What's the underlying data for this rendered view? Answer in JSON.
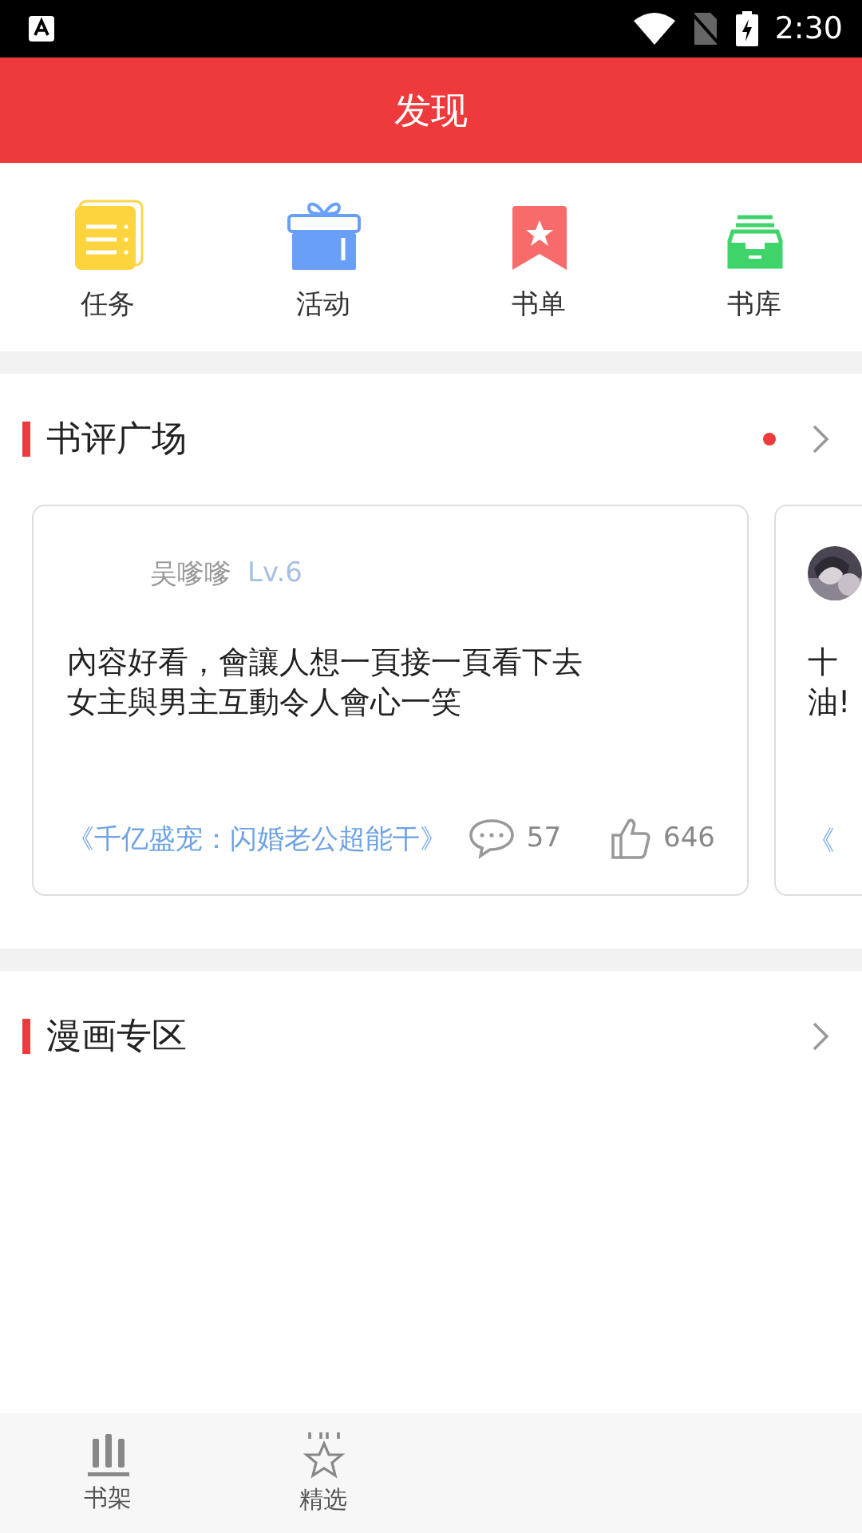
{
  "status_bar": {
    "time": "2:30"
  },
  "header": {
    "title": "发现"
  },
  "quick_nav": [
    {
      "label": "任务",
      "kind": "tasks"
    },
    {
      "label": "活动",
      "kind": "gift"
    },
    {
      "label": "书单",
      "kind": "booklist"
    },
    {
      "label": "书库",
      "kind": "library"
    }
  ],
  "review_section": {
    "title": "书评广场",
    "unread": true,
    "cards": [
      {
        "user": "吴嗲嗲",
        "level": "Lv.6",
        "has_avatar": false,
        "lines": [
          "內容好看，會讓人想一頁接一頁看下去",
          "女主與男主互動令人會心一笑"
        ],
        "book": "《千亿盛宠：闪婚老公超能干》",
        "comments": "57",
        "likes": "646"
      },
      {
        "has_avatar": true,
        "lines": [
          "十",
          "油!"
        ],
        "book": "《"
      }
    ]
  },
  "comic_section": {
    "title": "漫画专区",
    "unread": false
  },
  "bottom_nav": [
    {
      "label": "书架",
      "kind": "shelf",
      "selected": false
    },
    {
      "label": "精选",
      "kind": "featured",
      "selected": false
    }
  ]
}
